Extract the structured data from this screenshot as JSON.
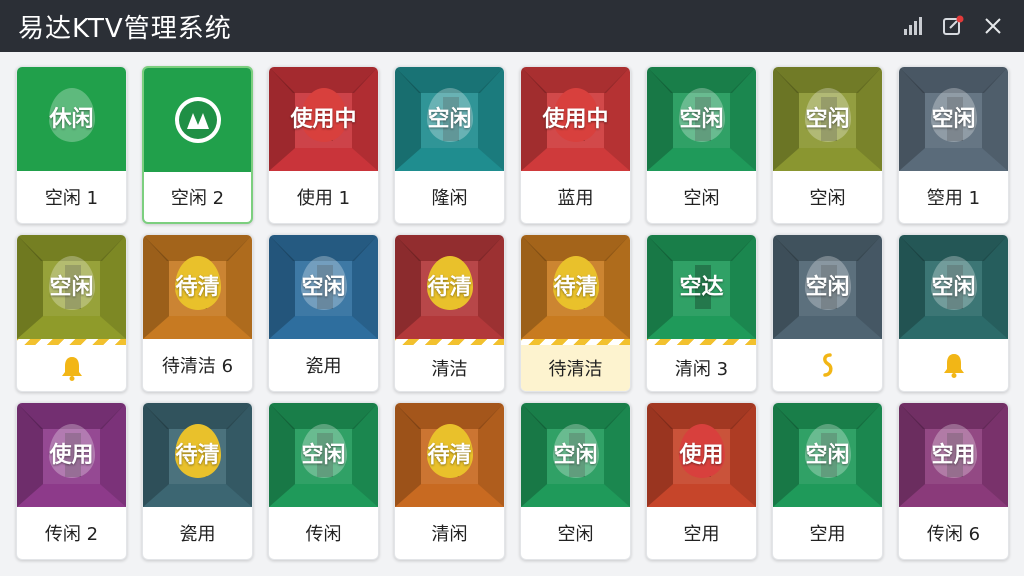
{
  "app": {
    "title": "易达KTV管理系统"
  },
  "window_controls": [
    {
      "name": "signal-icon"
    },
    {
      "name": "edit-notify-icon"
    },
    {
      "name": "close-icon"
    }
  ],
  "rooms": [
    {
      "color": "#21a04b",
      "flat": true,
      "drop": "glass",
      "status": "休闲",
      "label": "空闲 1",
      "label_type": "text"
    },
    {
      "color": "#21a04b",
      "flat": true,
      "drop": "none",
      "status": "",
      "label": "空闲 2",
      "label_type": "text",
      "selected": true,
      "logo": true
    },
    {
      "color": "#c9343a",
      "flat": false,
      "drop": "red",
      "status": "使用中",
      "label": "使用 1",
      "label_type": "text"
    },
    {
      "color": "#1f8d8f",
      "flat": false,
      "drop": "glass",
      "status": "空闲",
      "label": "隆闲",
      "label_type": "text"
    },
    {
      "color": "#cf3a3b",
      "flat": false,
      "drop": "red",
      "status": "使用中",
      "label": "蓝用",
      "label_type": "text"
    },
    {
      "color": "#1f9a5a",
      "flat": false,
      "drop": "glass",
      "status": "空闲",
      "label": "空闲",
      "label_type": "text"
    },
    {
      "color": "#8a9630",
      "flat": false,
      "drop": "glass",
      "status": "空闲",
      "label": "空闲",
      "label_type": "text"
    },
    {
      "color": "#5a6b7a",
      "flat": false,
      "drop": "glass",
      "status": "空闲",
      "label": "箜用 1",
      "label_type": "text"
    },
    {
      "color": "#8f9b2a",
      "flat": false,
      "drop": "glass",
      "status": "空闲",
      "label": "",
      "label_type": "bell",
      "stripe": true
    },
    {
      "color": "#c77a22",
      "flat": false,
      "drop": "yellow",
      "status": "待清",
      "label": "待清洁 6",
      "label_type": "text"
    },
    {
      "color": "#2e6e9e",
      "flat": false,
      "drop": "glass",
      "status": "空闲",
      "label": "瓷用",
      "label_type": "text"
    },
    {
      "color": "#b2383a",
      "flat": false,
      "drop": "yellow",
      "status": "待清",
      "label": "清洁",
      "label_type": "text",
      "stripe": true
    },
    {
      "color": "#c87b20",
      "flat": false,
      "drop": "yellow",
      "status": "待清",
      "label": "待清洁",
      "label_type": "text",
      "stripe": true,
      "label_bg": "yellow"
    },
    {
      "color": "#1f9a5a",
      "flat": false,
      "drop": "none",
      "status": "空达",
      "label": "清闲 3",
      "label_type": "text",
      "stripe": true
    },
    {
      "color": "#4f6472",
      "flat": false,
      "drop": "glass",
      "status": "空闲",
      "label": "",
      "label_type": "hook"
    },
    {
      "color": "#2c6b6a",
      "flat": false,
      "drop": "glass",
      "status": "空闲",
      "label": "",
      "label_type": "bell"
    },
    {
      "color": "#8d3a8a",
      "flat": false,
      "drop": "glass",
      "status": "使用",
      "label": "传闲 2",
      "label_type": "text"
    },
    {
      "color": "#3c6672",
      "flat": false,
      "drop": "yellow",
      "status": "待清",
      "label": "瓷用",
      "label_type": "text"
    },
    {
      "color": "#1f9a5a",
      "flat": false,
      "drop": "glass",
      "status": "空闲",
      "label": "传闲",
      "label_type": "text"
    },
    {
      "color": "#c86a21",
      "flat": false,
      "drop": "yellow",
      "status": "待清",
      "label": "清闲",
      "label_type": "text"
    },
    {
      "color": "#1f9a5a",
      "flat": false,
      "drop": "glass",
      "status": "空闲",
      "label": "空闲",
      "label_type": "text"
    },
    {
      "color": "#c6452a",
      "flat": false,
      "drop": "red",
      "status": "使用",
      "label": "空用",
      "label_type": "text"
    },
    {
      "color": "#1f9a5a",
      "flat": false,
      "drop": "glass",
      "status": "空闲",
      "label": "空用",
      "label_type": "text"
    },
    {
      "color": "#8a3a7a",
      "flat": false,
      "drop": "glass",
      "status": "空用",
      "label": "传闲 6",
      "label_type": "text"
    }
  ]
}
